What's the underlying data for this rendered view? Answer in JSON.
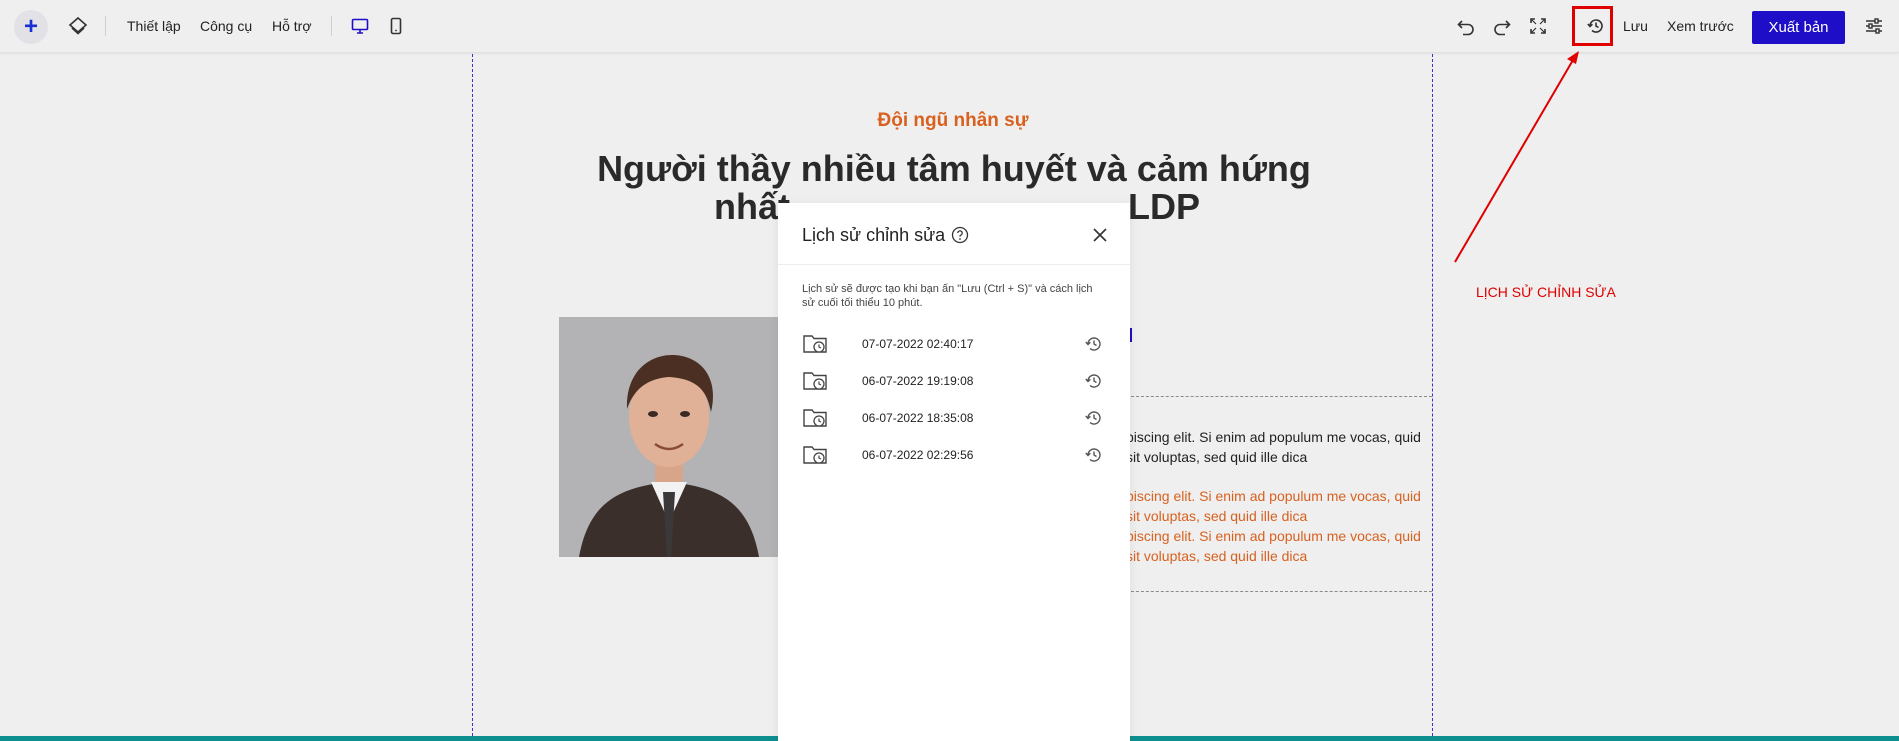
{
  "toolbar": {
    "add_label": "+",
    "menu_settings": "Thiết lập",
    "menu_tools": "Công cụ",
    "menu_help": "Hỗ trợ",
    "save_label": "Lưu",
    "preview_label": "Xem trước",
    "publish_label": "Xuất bản",
    "accent_color": "#1f0ec7",
    "icons": [
      "layers-icon",
      "desktop-icon",
      "mobile-icon",
      "undo-icon",
      "redo-icon",
      "fullscreen-icon",
      "history-icon",
      "settings-sliders-icon"
    ]
  },
  "canvas": {
    "eyebrow": "Đội ngũ nhân sự",
    "headline_line1": "Người thầy nhiều tâm huyết và cảm hứng",
    "headline_line2_left": "nhất",
    "headline_line2_right": "LDP",
    "body_dark": "piscing elit. Si enim ad populum me vocas, quid sit voluptas, sed quid ille dica",
    "body_orange_1": "piscing elit. Si enim ad populum me vocas, quid sit voluptas, sed quid ille dica",
    "body_orange_2": "piscing elit. Si enim ad populum me vocas, quid sit voluptas, sed quid ille dica",
    "accent_orange": "#d8611f"
  },
  "annotation": {
    "label": "LỊCH SỬ CHỈNH SỬA",
    "color": "#e00000"
  },
  "modal": {
    "title": "Lịch sử chỉnh sửa",
    "note": "Lịch sử sẽ được tạo khi bạn ấn \"Lưu (Ctrl + S)\" và cách lịch sử cuối tối thiểu 10 phút.",
    "entries": [
      {
        "timestamp": "07-07-2022 02:40:17"
      },
      {
        "timestamp": "06-07-2022 19:19:08"
      },
      {
        "timestamp": "06-07-2022 18:35:08"
      },
      {
        "timestamp": "06-07-2022 02:29:56"
      }
    ]
  }
}
